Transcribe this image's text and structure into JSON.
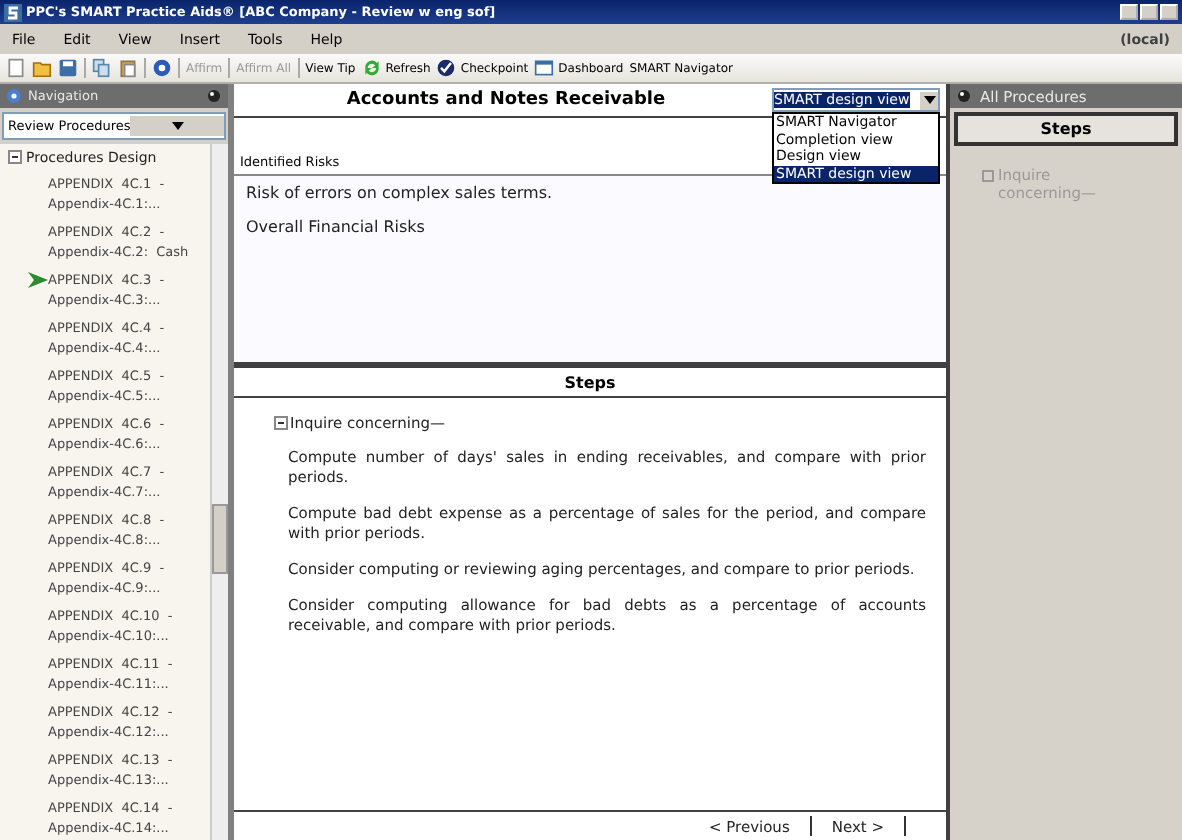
{
  "window": {
    "title": "PPC's SMART Practice Aids® [ABC Company - Review w eng sof]",
    "user": "(local)"
  },
  "menu": [
    "File",
    "Edit",
    "View",
    "Insert",
    "Tools",
    "Help"
  ],
  "toolbar": [
    {
      "kind": "new"
    },
    {
      "kind": "open"
    },
    {
      "kind": "save"
    },
    {
      "kind": "separator"
    },
    {
      "kind": "copy"
    },
    {
      "kind": "paste"
    },
    {
      "kind": "separator"
    },
    {
      "kind": "help"
    },
    {
      "kind": "separator"
    },
    {
      "kind": "text",
      "label": "Affirm",
      "disabled": true
    },
    {
      "kind": "separator"
    },
    {
      "kind": "text",
      "label": "Affirm All",
      "disabled": true
    },
    {
      "kind": "separator"
    },
    {
      "kind": "text",
      "label": "View Tip",
      "disabled": false
    },
    {
      "kind": "refresh",
      "label": "Refresh",
      "disabled": false
    },
    {
      "kind": "checkpoint",
      "label": "Checkpoint",
      "disabled": false
    },
    {
      "kind": "dashboard",
      "label": "Dashboard",
      "disabled": false
    },
    {
      "kind": "text",
      "label": "SMART Navigator",
      "disabled": false
    }
  ],
  "navigation": {
    "title": "Navigation",
    "dropdown": "Review Procedures",
    "tree": {
      "label": "Procedures Design",
      "expanded": true,
      "children": [
        {
          "title": "APPENDIX  4C.1  -",
          "subtitle": "Appendix-4C.1:...",
          "current": false
        },
        {
          "title": "APPENDIX  4C.2  -",
          "subtitle": "Appendix-4C.2:  Cash",
          "current": false
        },
        {
          "title": "APPENDIX  4C.3  -",
          "subtitle": "Appendix-4C.3:...",
          "current": true
        },
        {
          "title": "APPENDIX  4C.4  -",
          "subtitle": "Appendix-4C.4:...",
          "current": false
        },
        {
          "title": "APPENDIX  4C.5  -",
          "subtitle": "Appendix-4C.5:...",
          "current": false
        },
        {
          "title": "APPENDIX  4C.6  -",
          "subtitle": "Appendix-4C.6:...",
          "current": false
        },
        {
          "title": "APPENDIX  4C.7  -",
          "subtitle": "Appendix-4C.7:...",
          "current": false
        },
        {
          "title": "APPENDIX  4C.8  -",
          "subtitle": "Appendix-4C.8:...",
          "current": false
        },
        {
          "title": "APPENDIX  4C.9  -",
          "subtitle": "Appendix-4C.9:...",
          "current": false
        },
        {
          "title": "APPENDIX  4C.10  -",
          "subtitle": "Appendix-4C.10:...",
          "current": false
        },
        {
          "title": "APPENDIX  4C.11  -",
          "subtitle": "Appendix-4C.11:...",
          "current": false
        },
        {
          "title": "APPENDIX  4C.12  -",
          "subtitle": "Appendix-4C.12:...",
          "current": false
        },
        {
          "title": "APPENDIX  4C.13  -",
          "subtitle": "Appendix-4C.13:...",
          "current": false
        },
        {
          "title": "APPENDIX  4C.14  -",
          "subtitle": "Appendix-4C.14:...",
          "current": false
        }
      ]
    }
  },
  "document": {
    "title": "Accounts and Notes Receivable",
    "view_dropdown": {
      "value": "SMART design view",
      "expanded": true,
      "options": [
        {
          "label": "SMART Navigator",
          "selected": false
        },
        {
          "label": "Completion view",
          "selected": false
        },
        {
          "label": "Design view",
          "selected": false
        },
        {
          "label": "SMART design view",
          "selected": true
        }
      ]
    },
    "risks": {
      "label": "Identified Risks",
      "items": [
        "Risk of errors on complex sales terms.",
        "Overall Financial Risks"
      ]
    },
    "steps": {
      "title": "Steps",
      "group": {
        "label": "Inquire concerning—",
        "expanded": true,
        "children": [
          "Compute number of days' sales in ending receivables, and compare with prior periods.",
          "Compute bad debt expense as a percentage of sales for the period, and compare with prior periods.",
          "Consider computing or reviewing aging percentages, and compare to prior periods.",
          "Consider computing allowance for bad debts as a percentage of accounts receivable, and compare with prior periods."
        ]
      }
    },
    "buttons": [
      "< Previous",
      "Next >"
    ]
  },
  "all_procedures": {
    "title": "All Procedures",
    "header": "Steps",
    "items": [
      {
        "label": "Inquire concerning—",
        "disabled": true
      }
    ]
  }
}
